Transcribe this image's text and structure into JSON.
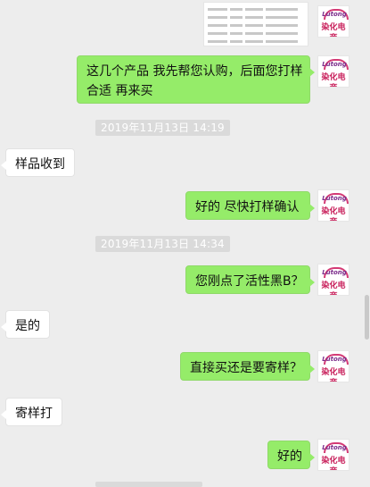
{
  "table_image": {
    "rows": 5
  },
  "messages": {
    "m1": {
      "text_line1": "这几个产品 我先帮您认购，后面您打样",
      "text_line2": "合适 再来买"
    },
    "t1": "2019年11月13日 14:19",
    "m2": "样品收到",
    "m3": "好的  尽快打样确认",
    "t2": "2019年11月13日 14:34",
    "m4": "您刚点了活性黑B？",
    "m5": "是的",
    "m6": "直接买还是要寄样？",
    "m7": "寄样打",
    "m8": "好的"
  },
  "avatar": {
    "brand_top": "Lutong",
    "brand_bottom": "染化电商"
  },
  "colors": {
    "background": "#ededed",
    "my_bubble": "#95ec69",
    "other_bubble": "#ffffff",
    "timestamp_bg": "#dadada"
  }
}
